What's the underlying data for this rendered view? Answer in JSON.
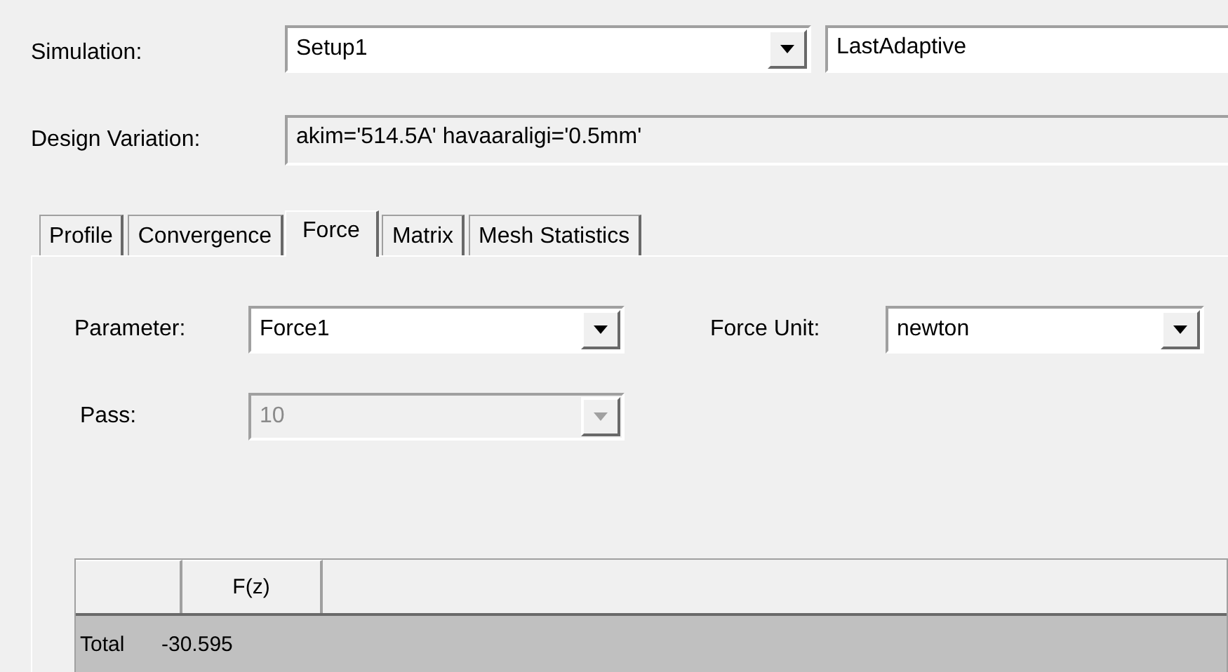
{
  "simulation": {
    "label": "Simulation:",
    "setup": "Setup1",
    "solution": "LastAdaptive"
  },
  "design_variation": {
    "label": "Design Variation:",
    "value": "akim='514.5A' havaaraligi='0.5mm'"
  },
  "tabs": [
    {
      "label": "Profile",
      "selected": false
    },
    {
      "label": "Convergence",
      "selected": false
    },
    {
      "label": "Force",
      "selected": true
    },
    {
      "label": "Matrix",
      "selected": false
    },
    {
      "label": "Mesh Statistics",
      "selected": false
    }
  ],
  "parameter": {
    "label": "Parameter:",
    "value": "Force1",
    "disabled": false
  },
  "force_unit": {
    "label": "Force Unit:",
    "value": "newton",
    "disabled": false
  },
  "pass": {
    "label": "Pass:",
    "value": "10",
    "disabled": true
  },
  "table": {
    "columns": [
      "F(z)"
    ],
    "rows": [
      {
        "label": "Total",
        "values": [
          "-30.595"
        ]
      }
    ]
  }
}
